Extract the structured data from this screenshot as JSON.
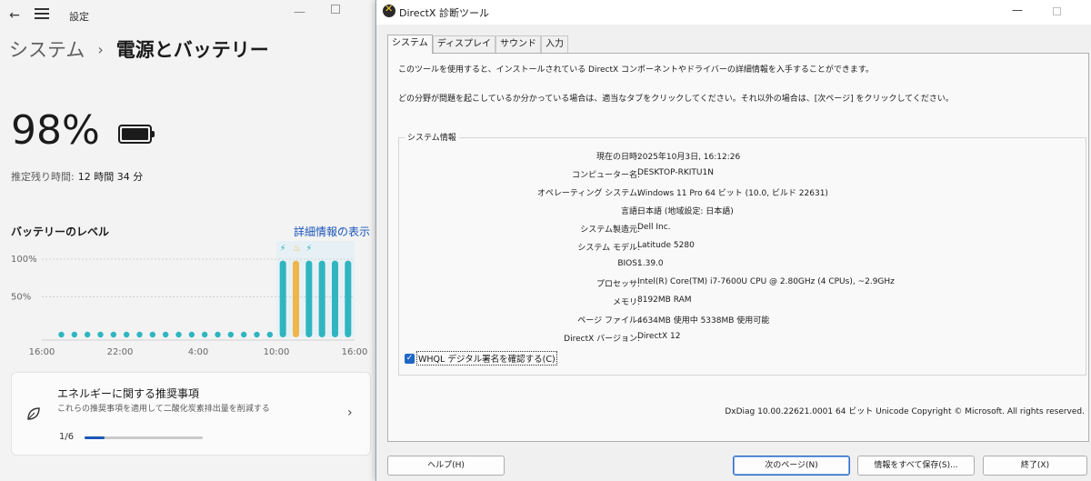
{
  "settings": {
    "app_title": "設定",
    "breadcrumb_parent": "システム",
    "breadcrumb_sep": "›",
    "page_title": "電源とバッテリー",
    "battery_percent": "98%",
    "remaining_label": "推定残り時間:",
    "remaining_value": "12 時間 34 分",
    "level_title": "バッテリーのレベル",
    "details_link": "詳細情報の表示",
    "recommendation": {
      "title": "エネルギーに関する推奨事項",
      "subtitle": "これらの推奨事項を適用して二酸化炭素排出量を削減する",
      "progress_text": "1/6",
      "progress_fraction": 0.1667
    }
  },
  "chart_data": {
    "type": "bar",
    "title": "",
    "ylabel": "",
    "yticks": [
      "100%",
      "50%"
    ],
    "ylim": [
      0,
      100
    ],
    "xticks": [
      "16:00",
      "22:00",
      "4:00",
      "10:00",
      "16:00"
    ],
    "x_range": [
      0,
      24
    ],
    "bars": [
      {
        "x": 1.5,
        "value": 0
      },
      {
        "x": 2.5,
        "value": 0
      },
      {
        "x": 3.5,
        "value": 0
      },
      {
        "x": 4.5,
        "value": 0
      },
      {
        "x": 5.5,
        "value": 0
      },
      {
        "x": 6.5,
        "value": 0
      },
      {
        "x": 7.5,
        "value": 0
      },
      {
        "x": 8.5,
        "value": 0
      },
      {
        "x": 9.5,
        "value": 0
      },
      {
        "x": 10.5,
        "value": 0
      },
      {
        "x": 11.5,
        "value": 0
      },
      {
        "x": 12.5,
        "value": 0
      },
      {
        "x": 13.5,
        "value": 0
      },
      {
        "x": 14.5,
        "value": 0
      },
      {
        "x": 15.5,
        "value": 0
      },
      {
        "x": 16.5,
        "value": 0
      },
      {
        "x": 17.5,
        "value": 0
      },
      {
        "x": 18.5,
        "value": 98,
        "state": "charging"
      },
      {
        "x": 19.5,
        "value": 98,
        "state": "saver"
      },
      {
        "x": 20.5,
        "value": 98,
        "state": "charging"
      },
      {
        "x": 21.5,
        "value": 98
      },
      {
        "x": 22.5,
        "value": 98
      },
      {
        "x": 23.5,
        "value": 98
      }
    ],
    "colors": {
      "normal": "#2fb5c0",
      "saver": "#f0b64a",
      "empty": "#2fb5c0",
      "grid": "#d2d2d2",
      "highlight": "#e7f1f5"
    }
  },
  "dxdiag": {
    "window_title": "DirectX 診断ツール",
    "min_glyph": "—",
    "tabs": [
      "システム",
      "ディスプレイ",
      "サウンド",
      "入力"
    ],
    "intro1": "このツールを使用すると、インストールされている DirectX コンポーネントやドライバーの詳細情報を入手することができます。",
    "intro2": "どの分野が問題を起こしているか分かっている場合は、適当なタブをクリックしてください。それ以外の場合は、[次ページ] をクリックしてください。",
    "group_label": "システム情報",
    "info": [
      {
        "label": "現在の日時:",
        "value": "2025年10月3日, 16:12:26"
      },
      {
        "label": "コンピューター名:",
        "value": "DESKTOP-RKITU1N"
      },
      {
        "label": "オペレーティング システム:",
        "value": "Windows 11 Pro 64 ビット (10.0, ビルド 22631)"
      },
      {
        "label": "言語:",
        "value": "日本語 (地域設定: 日本語)"
      },
      {
        "label": "システム製造元:",
        "value": "Dell Inc."
      },
      {
        "label": "システム モデル:",
        "value": "Latitude 5280"
      },
      {
        "label": "BIOS:",
        "value": "1.39.0"
      },
      {
        "label": "プロセッサ:",
        "value": "Intel(R) Core(TM) i7-7600U CPU @ 2.80GHz (4 CPUs), ~2.9GHz"
      },
      {
        "label": "メモリ:",
        "value": "8192MB RAM"
      },
      {
        "label": "ページ ファイル:",
        "value": "4634MB 使用中 5338MB 使用可能"
      },
      {
        "label": "DirectX バージョン:",
        "value": "DirectX 12"
      }
    ],
    "whql_label": "WHQL デジタル署名を確認する(C)",
    "whql_checked": true,
    "footer": "DxDiag 10.00.22621.0001 64 ビット Unicode  Copyright © Microsoft. All rights reserved.",
    "buttons": {
      "help": "ヘルプ(H)",
      "next": "次のページ(N)",
      "save_all": "情報をすべて保存(S)...",
      "exit": "終了(X)"
    }
  }
}
